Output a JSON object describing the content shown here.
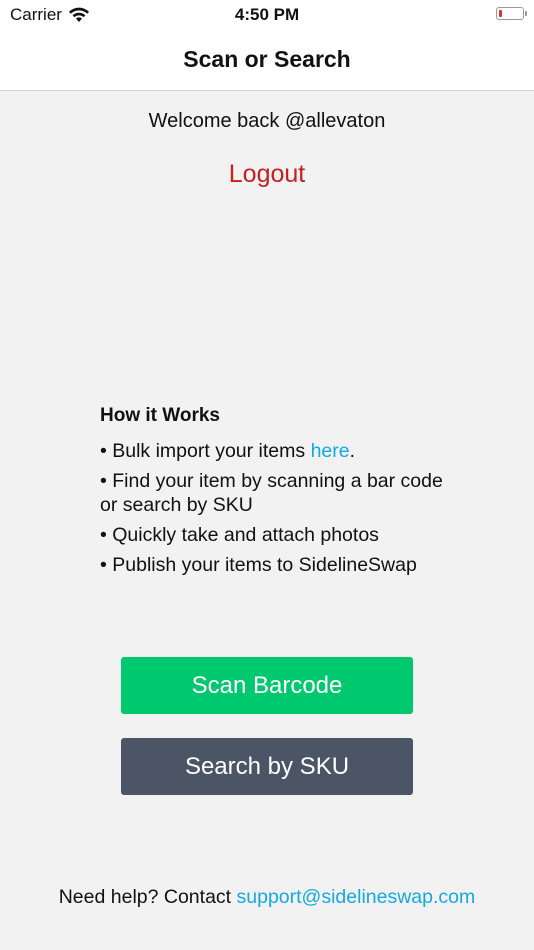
{
  "status_bar": {
    "carrier": "Carrier",
    "time": "4:50 PM",
    "battery_level": 0.12,
    "battery_color": "#e0312b"
  },
  "nav": {
    "title": "Scan or Search"
  },
  "account": {
    "welcome": "Welcome back @allevaton",
    "logout_label": "Logout"
  },
  "how_it_works": {
    "title": "How it Works",
    "bullet": "•",
    "item1_prefix": "Bulk import your items ",
    "item1_link": "here",
    "item1_suffix": ".",
    "item2": "Find your item by scanning a bar code or search by SKU",
    "item3": "Quickly take and attach photos",
    "item4": "Publish your items to SidelineSwap"
  },
  "actions": {
    "scan_label": "Scan Barcode",
    "sku_label": "Search by SKU"
  },
  "help": {
    "prefix": "Need help? Contact ",
    "email": "support@sidelineswap.com"
  },
  "colors": {
    "scan_button": "#00c86e",
    "sku_button": "#4b5566",
    "logout": "#c81e1e",
    "link": "#12a9e4"
  }
}
